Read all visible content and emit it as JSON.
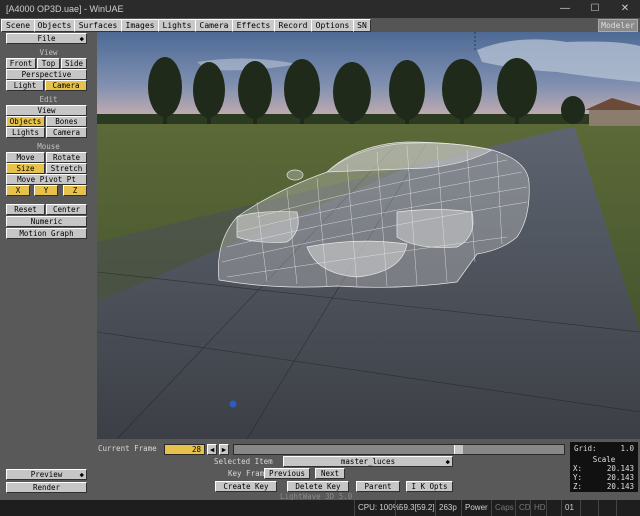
{
  "window": {
    "title": "[A4000 OP3D.uae] - WinUAE",
    "minimize": "—",
    "maximize": "☐",
    "close": "✕"
  },
  "menu": {
    "tabs": [
      "Scene",
      "Objects",
      "Surfaces",
      "Images",
      "Lights",
      "Camera",
      "Effects",
      "Record",
      "Options",
      "SN"
    ],
    "modeler": "Modeler"
  },
  "left": {
    "file": "File",
    "view_title": "View",
    "front": "Front",
    "top": "Top",
    "side": "Side",
    "perspective": "Perspective",
    "light": "Light",
    "camera": "Camera",
    "edit_title": "Edit",
    "edit_view": "View",
    "objects": "Objects",
    "bones": "Bones",
    "lights": "Lights",
    "edit_camera": "Camera",
    "mouse_title": "Mouse",
    "move": "Move",
    "rotate": "Rotate",
    "size": "Size",
    "stretch": "Stretch",
    "move_pivot": "Move Pivot Pt",
    "x": "X",
    "y": "Y",
    "z": "Z",
    "reset": "Reset",
    "center": "Center",
    "numeric": "Numeric",
    "motion_graph": "Motion Graph",
    "preview": "Preview",
    "render": "Render"
  },
  "bottom": {
    "current_frame_label": "Current Frame",
    "current_frame": "28",
    "grid_label": "Grid:",
    "grid_value": "1.0",
    "selected_item_label": "Selected Item",
    "selected_item": "master_luces",
    "key_frame_label": "Key Frame",
    "previous": "Previous",
    "next": "Next",
    "create_key": "Create Key",
    "delete_key": "Delete Key",
    "parent": "Parent",
    "ik_opts": "I K Opts",
    "version": "LightWave 3D 5.0",
    "frame_slider_fraction": 0.68
  },
  "scale": {
    "title": "Scale",
    "x_label": "X:",
    "x": "20.143",
    "y_label": "Y:",
    "y": "20.143",
    "z_label": "Z:",
    "z": "20.143"
  },
  "status": {
    "cpu": "CPU: 100%",
    "fps": "59.3[59.2]",
    "lines": "263p",
    "power": "Power",
    "caps": "Caps",
    "cd": "CD",
    "hd": "HD",
    "df": "01"
  },
  "colors": {
    "accent": "#e6c24a",
    "panel": "#595959",
    "button": "#c6c6c6",
    "wireframe": "#e8e8e8"
  }
}
